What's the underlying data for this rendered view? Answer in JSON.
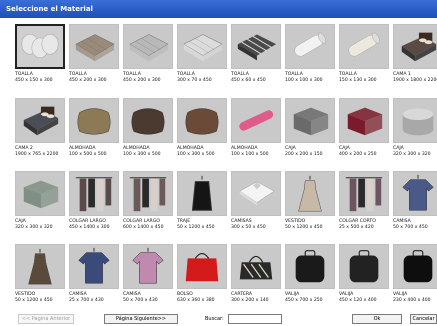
{
  "window": {
    "title": "Seleccione el Material"
  },
  "items": [
    {
      "name": "TOALLA",
      "dims": "450 x 150 x 300",
      "icon": "towel-rolled-icon",
      "color": "#e8e8e8",
      "selected": true
    },
    {
      "name": "TOALLA",
      "dims": "450 x 200 x 300",
      "icon": "towel-folded-icon",
      "color": "#9a8a7a",
      "selected": false
    },
    {
      "name": "TOALLA",
      "dims": "450 x 200 x 300",
      "icon": "towel-folded-icon",
      "color": "#b8b8b8",
      "selected": false
    },
    {
      "name": "TOALLA",
      "dims": "300 x 70 x 450",
      "icon": "towel-folded-icon",
      "color": "#dcdcdc",
      "selected": false
    },
    {
      "name": "TOALLA",
      "dims": "450 x 60 x 450",
      "icon": "towel-striped-icon",
      "color": "#4a4a4a",
      "selected": false
    },
    {
      "name": "TOALLA",
      "dims": "100 x 100 x 300",
      "icon": "towel-roll-icon",
      "color": "#f2f2f2",
      "selected": false
    },
    {
      "name": "TOALLA",
      "dims": "150 x 130 x 300",
      "icon": "towel-roll-icon",
      "color": "#ebe8dd",
      "selected": false
    },
    {
      "name": "CAMA 1",
      "dims": "1900 x 1800 x 2200",
      "icon": "bed-icon",
      "color": "#5a4a44",
      "selected": false
    },
    {
      "name": "CAMA 2",
      "dims": "1900 x 765 x 2200",
      "icon": "bed-icon",
      "color": "#4a4d55",
      "selected": false
    },
    {
      "name": "ALMOHADA",
      "dims": "100 x 500 x 500",
      "icon": "pillow-icon",
      "color": "#8b7a55",
      "selected": false
    },
    {
      "name": "ALMOHADA",
      "dims": "100 x 300 x 500",
      "icon": "pillow-icon",
      "color": "#4a3a30",
      "selected": false
    },
    {
      "name": "ALMOHADA",
      "dims": "100 x 300 x 500",
      "icon": "pillow-icon",
      "color": "#6b4a38",
      "selected": false
    },
    {
      "name": "ALMOHADA",
      "dims": "100 x 100 x 500",
      "icon": "bolster-icon",
      "color": "#e05a8a",
      "selected": false
    },
    {
      "name": "CAJA",
      "dims": "200 x 200 x 150",
      "icon": "box-icon",
      "color": "#6a6a6a",
      "selected": false
    },
    {
      "name": "CAJA",
      "dims": "400 x 200 x 250",
      "icon": "box-icon",
      "color": "#7a1a2a",
      "selected": false
    },
    {
      "name": "CAJA",
      "dims": "320 x 300 x 320",
      "icon": "round-box-icon",
      "color": "#a8a8a8",
      "selected": false
    },
    {
      "name": "CAJA",
      "dims": "320 x 300 x 320",
      "icon": "box-icon",
      "color": "#7f8f84",
      "selected": false
    },
    {
      "name": "COLGAR LARGO",
      "dims": "450 x 1400 x 300",
      "icon": "hanging-clothes-icon",
      "color": "#5a4a4a",
      "selected": false
    },
    {
      "name": "COLGAR LARGO",
      "dims": "600 x 1400 x 450",
      "icon": "hanging-clothes-icon",
      "color": "#6a5a5a",
      "selected": false
    },
    {
      "name": "TRAJE",
      "dims": "50 x 1200 x 450",
      "icon": "suit-bag-icon",
      "color": "#151515",
      "selected": false
    },
    {
      "name": "CAMISAS",
      "dims": "300 x 50 x 450",
      "icon": "folded-shirt-icon",
      "color": "#f4f4f4",
      "selected": false
    },
    {
      "name": "VESTIDO",
      "dims": "50 x 1200 x 450",
      "icon": "dress-icon",
      "color": "#c8b8a8",
      "selected": false
    },
    {
      "name": "COLGAR CORTO",
      "dims": "25 x 500 x 420",
      "icon": "hanging-clothes-icon",
      "color": "#6a5560",
      "selected": false
    },
    {
      "name": "CAMISA",
      "dims": "50 x 700 x 450",
      "icon": "shirt-icon",
      "color": "#4a5a88",
      "selected": false
    },
    {
      "name": "VESTIDO",
      "dims": "50 x 1200 x 450",
      "icon": "dress-icon",
      "color": "#5a4a3a",
      "selected": false
    },
    {
      "name": "CAMISA",
      "dims": "25 x 700 x 430",
      "icon": "shirt-icon",
      "color": "#3a4a7a",
      "selected": false
    },
    {
      "name": "CAMISA",
      "dims": "50 x 700 x 430",
      "icon": "shirt-icon",
      "color": "#c08ab0",
      "selected": false
    },
    {
      "name": "BOLSO",
      "dims": "630 x 360 x 380",
      "icon": "tote-bag-icon",
      "color": "#d41a1a",
      "selected": false
    },
    {
      "name": "CARTERA",
      "dims": "300 x 200 x 140",
      "icon": "purse-icon",
      "color": "#2a2a2a",
      "selected": false
    },
    {
      "name": "VALIJA",
      "dims": "450 x 700 x 250",
      "icon": "suitcase-icon",
      "color": "#1a1a1a",
      "selected": false
    },
    {
      "name": "VALIJA",
      "dims": "450 x 120 x 400",
      "icon": "suitcase-icon",
      "color": "#222222",
      "selected": false
    },
    {
      "name": "VALIJA",
      "dims": "230 x 400 x 400",
      "icon": "suitcase-icon",
      "color": "#0e0e0e",
      "selected": false
    }
  ],
  "footer": {
    "prev_label": "<< Pagina Anterior",
    "next_label": "Página Siguiente>>",
    "search_label": "Buscar:",
    "search_value": "",
    "ok_label": "Ok",
    "cancel_label": "Cancelar"
  }
}
